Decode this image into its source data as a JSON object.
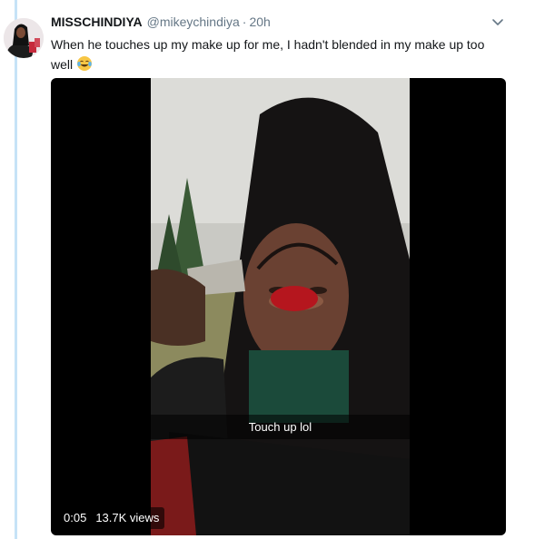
{
  "tweet": {
    "display_name": "MISSCHINDIYA",
    "handle": "@mikeychindiya",
    "separator": "·",
    "time": "20h",
    "text": "When he touches up my make up for me, I hadn't blended in my make up too well",
    "emoji": "face-with-tears-of-joy"
  },
  "video": {
    "caption": "Touch up lol",
    "duration": "0:05",
    "views": "13.7K views"
  },
  "colors": {
    "thread_line": "#c6e3f7",
    "name": "#14171a",
    "muted": "#657786",
    "media_bg": "#000000"
  },
  "icons": {
    "caret": "chevron-down-icon",
    "avatar": "avatar"
  }
}
